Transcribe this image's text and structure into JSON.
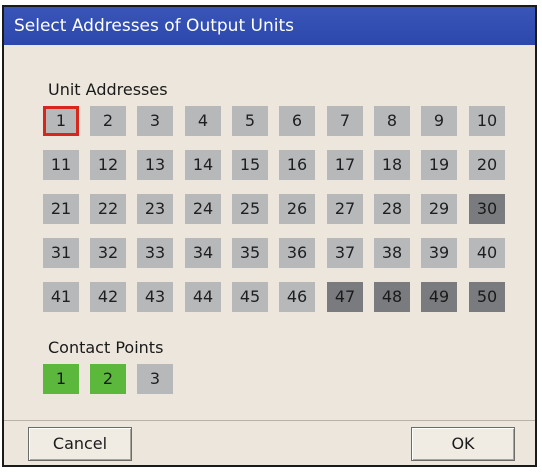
{
  "dialog": {
    "title": "Select Addresses of Output Units",
    "unit_addresses_label": "Unit Addresses",
    "contact_points_label": "Contact Points",
    "cancel_label": "Cancel",
    "ok_label": "OK"
  },
  "unit_addresses": [
    {
      "label": "1",
      "state": "focused"
    },
    {
      "label": "2",
      "state": "normal"
    },
    {
      "label": "3",
      "state": "normal"
    },
    {
      "label": "4",
      "state": "normal"
    },
    {
      "label": "5",
      "state": "normal"
    },
    {
      "label": "6",
      "state": "normal"
    },
    {
      "label": "7",
      "state": "normal"
    },
    {
      "label": "8",
      "state": "normal"
    },
    {
      "label": "9",
      "state": "normal"
    },
    {
      "label": "10",
      "state": "normal"
    },
    {
      "label": "11",
      "state": "normal"
    },
    {
      "label": "12",
      "state": "normal"
    },
    {
      "label": "13",
      "state": "normal"
    },
    {
      "label": "14",
      "state": "normal"
    },
    {
      "label": "15",
      "state": "normal"
    },
    {
      "label": "16",
      "state": "normal"
    },
    {
      "label": "17",
      "state": "normal"
    },
    {
      "label": "18",
      "state": "normal"
    },
    {
      "label": "19",
      "state": "normal"
    },
    {
      "label": "20",
      "state": "normal"
    },
    {
      "label": "21",
      "state": "normal"
    },
    {
      "label": "22",
      "state": "normal"
    },
    {
      "label": "23",
      "state": "normal"
    },
    {
      "label": "24",
      "state": "normal"
    },
    {
      "label": "25",
      "state": "normal"
    },
    {
      "label": "26",
      "state": "normal"
    },
    {
      "label": "27",
      "state": "normal"
    },
    {
      "label": "28",
      "state": "normal"
    },
    {
      "label": "29",
      "state": "normal"
    },
    {
      "label": "30",
      "state": "selected"
    },
    {
      "label": "31",
      "state": "normal"
    },
    {
      "label": "32",
      "state": "normal"
    },
    {
      "label": "33",
      "state": "normal"
    },
    {
      "label": "34",
      "state": "normal"
    },
    {
      "label": "35",
      "state": "normal"
    },
    {
      "label": "36",
      "state": "normal"
    },
    {
      "label": "37",
      "state": "normal"
    },
    {
      "label": "38",
      "state": "normal"
    },
    {
      "label": "39",
      "state": "normal"
    },
    {
      "label": "40",
      "state": "normal"
    },
    {
      "label": "41",
      "state": "normal"
    },
    {
      "label": "42",
      "state": "normal"
    },
    {
      "label": "43",
      "state": "normal"
    },
    {
      "label": "44",
      "state": "normal"
    },
    {
      "label": "45",
      "state": "normal"
    },
    {
      "label": "46",
      "state": "normal"
    },
    {
      "label": "47",
      "state": "selected"
    },
    {
      "label": "48",
      "state": "selected"
    },
    {
      "label": "49",
      "state": "selected"
    },
    {
      "label": "50",
      "state": "selected"
    }
  ],
  "contact_points": [
    {
      "label": "1",
      "state": "green"
    },
    {
      "label": "2",
      "state": "green"
    },
    {
      "label": "3",
      "state": "normal"
    }
  ],
  "colors": {
    "title_bar": "#2c48ac",
    "dialog_bg": "#ece6dc",
    "cell_normal": "#b7b8ba",
    "cell_selected": "#7a7b7e",
    "cell_green": "#5cb83c",
    "focus_border": "#d9261c"
  }
}
